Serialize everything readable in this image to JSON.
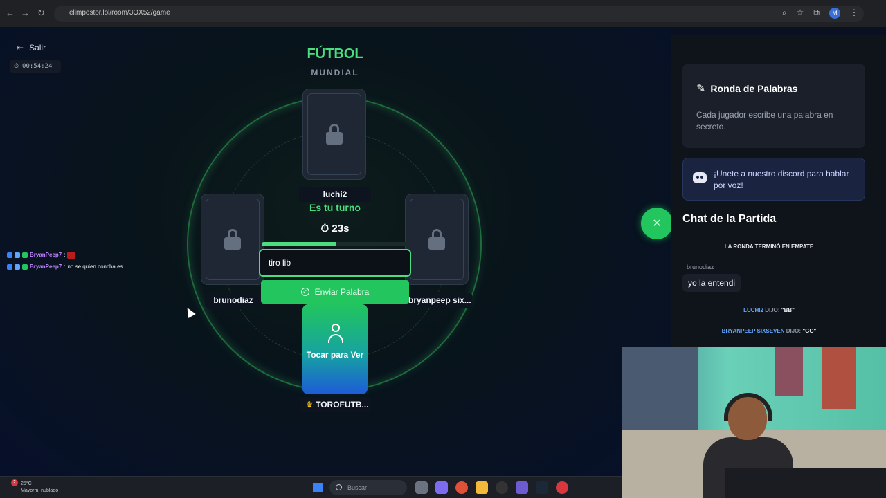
{
  "browser": {
    "url": "elimpostor.lol/room/3OX52/game",
    "profile_initial": "M"
  },
  "game": {
    "exit_label": "Salir",
    "elapsed_time": "00:54:24",
    "title": "FÚTBOL",
    "subtitle": "MUNDIAL",
    "turn_label": "Es tu turno",
    "countdown": "23s",
    "progress_fraction": 0.5,
    "input_value": "tiro lib",
    "submit_label": "Enviar Palabra",
    "my_card_label": "Tocar para Ver",
    "players": {
      "top": "luchi2",
      "left": "brunodiaz",
      "right": "bryanpeep six...",
      "bottom": "TOROFUTB..."
    }
  },
  "stream_chat": [
    {
      "user": "BryanPeep7",
      "text": ""
    },
    {
      "user": "BryanPeep7",
      "text": "no se quien concha es"
    }
  ],
  "sidebar": {
    "panel_title": "Ronda de Palabras",
    "panel_description": "Cada jugador escribe una palabra en secreto.",
    "discord_text": "¡Unete a nuestro discord para hablar por voz!",
    "chat_heading": "Chat de la Partida",
    "system_round": "LA RONDA TERMINÓ EN EMPATE",
    "message_user": "brunodiaz",
    "message_text": "yo la entendi",
    "said": [
      {
        "name": "LUCHI2",
        "dijo": "DIJO:",
        "word": "\"BB\""
      },
      {
        "name": "BRYANPEEP SIXSEVEN",
        "dijo": "DIJO:",
        "word": "\"GG\""
      }
    ]
  },
  "taskbar": {
    "weather_temp": "25°C",
    "weather_desc": "Mayorm. nublado",
    "notification_count": "2",
    "search_placeholder": "Buscar"
  },
  "colors": {
    "accent_green": "#22c55e",
    "title_green": "#4ade80",
    "chat_blue": "#60a5fa"
  }
}
